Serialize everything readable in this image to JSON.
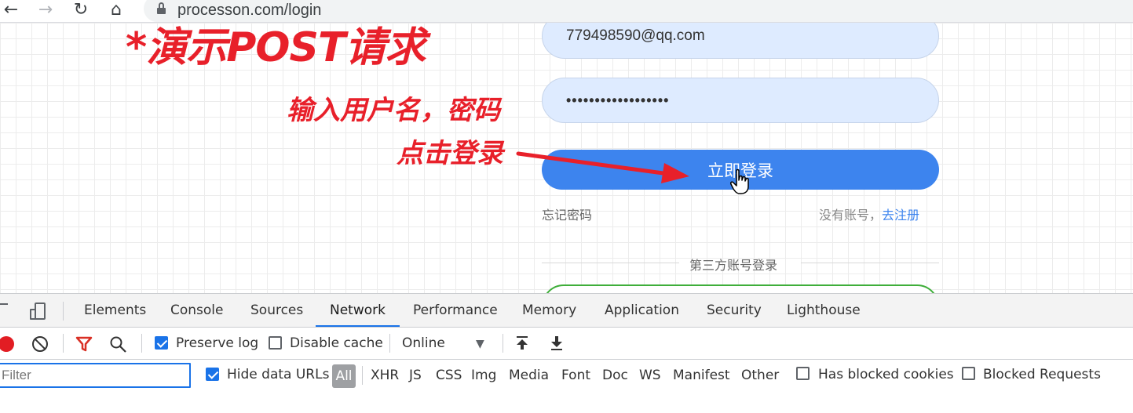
{
  "browser": {
    "url": "processon.com/login"
  },
  "annotation": {
    "title": "*演示POST请求",
    "step1": "输入用户名，密码",
    "step2": "点击登录"
  },
  "login": {
    "email_value": "779498590@qq.com",
    "password_value": "••••••••••••••••••",
    "login_button": "立即登录",
    "forgot_password": "忘记密码",
    "no_account": "没有账号，",
    "register_link": "去注册",
    "third_party": "第三方账号登录"
  },
  "devtools": {
    "tabs": [
      "Elements",
      "Console",
      "Sources",
      "Network",
      "Performance",
      "Memory",
      "Application",
      "Security",
      "Lighthouse"
    ],
    "active_tab": "Network",
    "preserve_log": "Preserve log",
    "preserve_log_checked": true,
    "disable_cache": "Disable cache",
    "disable_cache_checked": false,
    "throttling": "Online",
    "filter_placeholder": "Filter",
    "hide_data_urls": "Hide data URLs",
    "hide_data_urls_checked": true,
    "types": [
      "All",
      "XHR",
      "JS",
      "CSS",
      "Img",
      "Media",
      "Font",
      "Doc",
      "WS",
      "Manifest",
      "Other"
    ],
    "has_blocked_cookies": "Has blocked cookies",
    "blocked_requests": "Blocked Requests"
  },
  "colors": {
    "accent": "#3d84ee",
    "annotation": "#e8202a",
    "record": "#e21d23",
    "devtools_blue": "#1a73e8"
  }
}
